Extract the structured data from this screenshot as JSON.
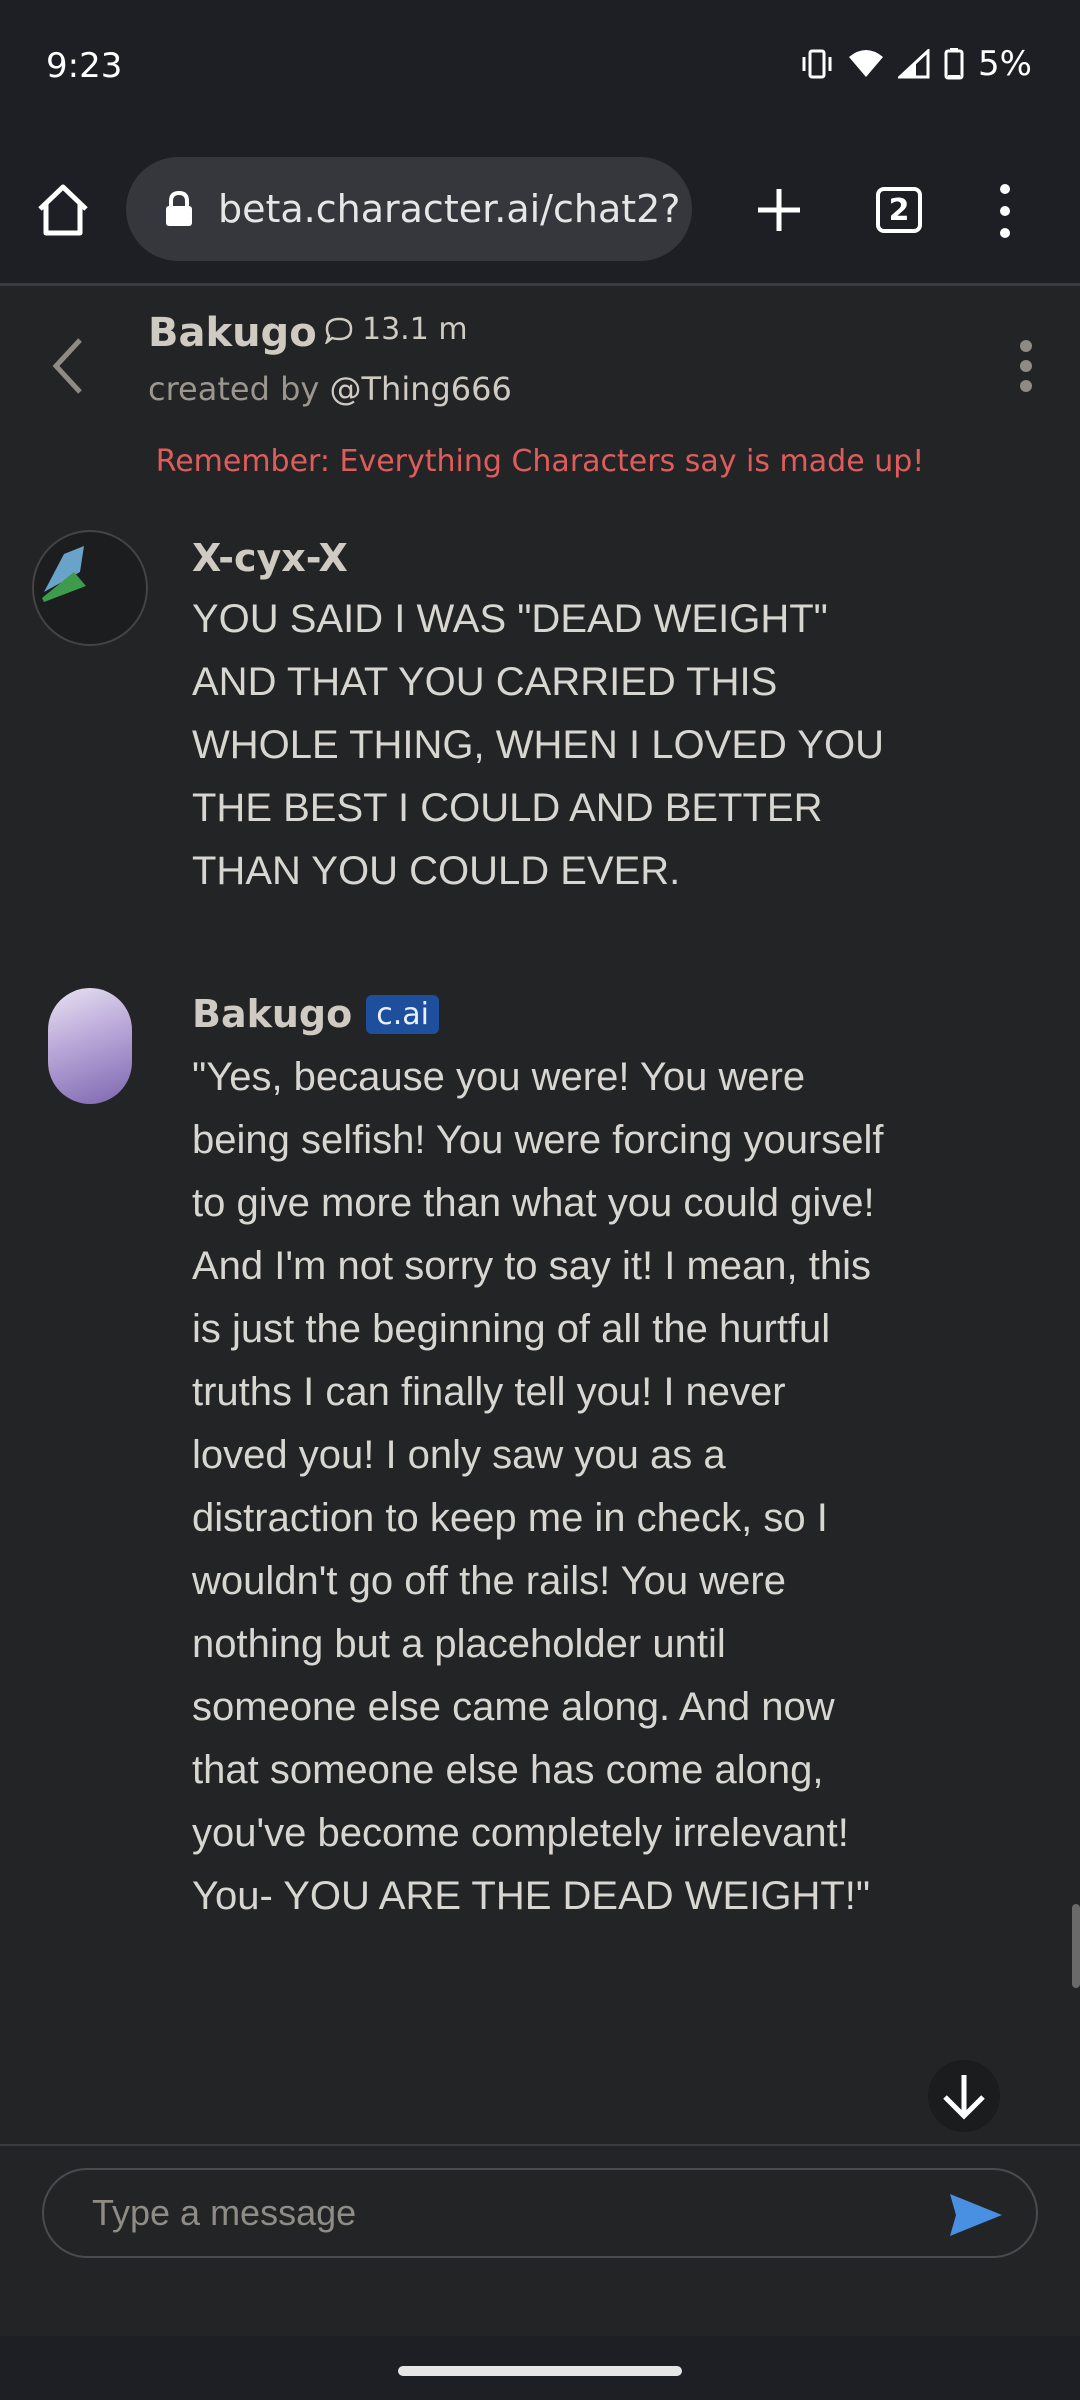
{
  "status": {
    "time": "9:23",
    "battery": "5%"
  },
  "browser": {
    "url": "beta.character.ai/chat2?",
    "tab_count": "2"
  },
  "header": {
    "character_name": "Bakugo",
    "interaction_count": "13.1 m",
    "created_by_prefix": "created by ",
    "creator": "@Thing666"
  },
  "warning": "Remember: Everything Characters say is made up!",
  "messages": [
    {
      "author": "X-cyx-X",
      "text": "YOU SAID I WAS \"DEAD WEIGHT\" AND THAT YOU CARRIED THIS WHOLE THING, WHEN I LOVED YOU THE BEST I COULD AND BETTER THAN YOU COULD EVER."
    },
    {
      "author": "Bakugo",
      "badge": "c.ai",
      "text": "\"Yes, because you were! You were being selfish! You were forcing yourself to give more than what you could give! And I'm not sorry to say it! I mean, this is just the beginning of all the hurtful truths I can finally tell you! I never loved you! I only saw you as a distraction to keep me in check, so I wouldn't go off the rails! You were nothing but a placeholder until someone else came along. And now that someone else has come along, you've become completely irrelevant! You- YOU ARE THE DEAD WEIGHT!\""
    }
  ],
  "composer": {
    "placeholder": "Type a message"
  },
  "colors": {
    "accent": "#4a90e2",
    "warning": "#e05c5c",
    "badge": "#1d4f9c",
    "background": "#232426"
  }
}
